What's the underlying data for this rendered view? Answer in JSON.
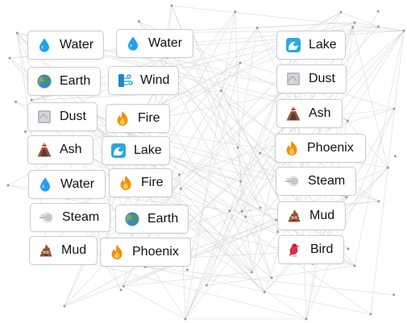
{
  "left_board": [
    {
      "label": "Water",
      "icon": "water-drop-icon"
    },
    {
      "label": "Water",
      "icon": "water-drop-icon"
    },
    {
      "label": "Earth",
      "icon": "earth-globe-icon"
    },
    {
      "label": "Wind",
      "icon": "wind-icon"
    },
    {
      "label": "Dust",
      "icon": "dust-icon"
    },
    {
      "label": "Fire",
      "icon": "fire-icon"
    },
    {
      "label": "Ash",
      "icon": "volcano-icon"
    },
    {
      "label": "Lake",
      "icon": "wave-icon"
    },
    {
      "label": "Water",
      "icon": "water-drop-icon"
    },
    {
      "label": "Fire",
      "icon": "fire-icon"
    },
    {
      "label": "Steam",
      "icon": "steam-icon"
    },
    {
      "label": "Earth",
      "icon": "earth-globe-icon"
    },
    {
      "label": "Mud",
      "icon": "mud-icon"
    },
    {
      "label": "Phoenix",
      "icon": "fire-icon"
    }
  ],
  "sidebar": [
    {
      "label": "Lake",
      "icon": "wave-icon"
    },
    {
      "label": "Dust",
      "icon": "dust-icon"
    },
    {
      "label": "Ash",
      "icon": "volcano-icon"
    },
    {
      "label": "Phoenix",
      "icon": "fire-icon"
    },
    {
      "label": "Steam",
      "icon": "steam-icon"
    },
    {
      "label": "Mud",
      "icon": "mud-icon"
    },
    {
      "label": "Bird",
      "icon": "bird-icon"
    }
  ],
  "colors": {
    "tile_border": "#c8ccd2",
    "text": "#111111",
    "web_line": "#d9d9d9",
    "web_dot": "#9a9a9a"
  }
}
